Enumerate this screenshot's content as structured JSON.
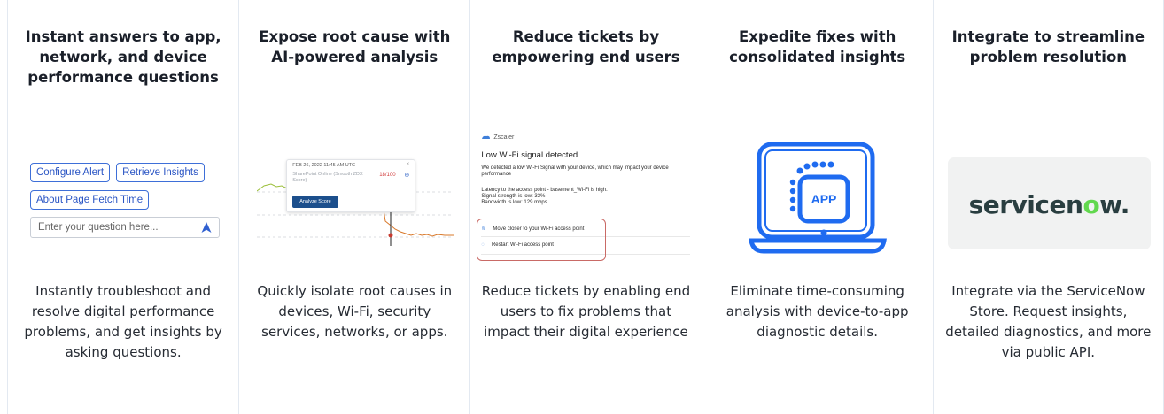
{
  "columns": [
    {
      "title": "Instant answers to app, network, and device performance questions",
      "chips": [
        "Configure Alert",
        "Retrieve Insights",
        "About Page Fetch Time"
      ],
      "input_placeholder": "Enter your question here...",
      "description": "Instantly troubleshoot and resolve digital performance problems, and get insights by asking questions."
    },
    {
      "title": "Expose root cause with AI-powered analysis",
      "tooltip": {
        "date": "FEB 26, 2022 11:45 AM UTC",
        "app": "SharePoint Online (Smooth ZDX Score)",
        "score": "18/100",
        "button": "Analyze Score"
      },
      "description": "Quickly isolate root causes in devices, Wi-Fi, security services, networks, or apps."
    },
    {
      "title": "Reduce tickets by empowering end users",
      "notification": {
        "brand": "Zscaler",
        "heading": "Low Wi-Fi signal detected",
        "body": "We detected a low Wi-Fi Signal with your device, which may impact your device performance",
        "details": [
          "Latency to the access point - basement_Wi-Fi is high.",
          "Signal strength is low: 33%",
          "Bandwidth is low: 129 mbps"
        ],
        "options": [
          "Move closer to your Wi-Fi access point",
          "Restart Wi-Fi access point"
        ]
      },
      "description": "Reduce tickets by enabling end users to fix problems that impact their digital experience"
    },
    {
      "title": "Expedite fixes with consolidated insights",
      "app_label": "APP",
      "description": "Eliminate time-consuming analysis with device-to-app diagnostic details."
    },
    {
      "title": "Integrate to streamline problem resolution",
      "logo": {
        "before": "servicen",
        "o": "o",
        "after": "w."
      },
      "description": "Integrate via the ServiceNow Store. Request insights, detailed diagnostics, and more via public API."
    }
  ],
  "colors": {
    "chip_blue": "#2a55c4",
    "laptop_blue": "#1f6bf0",
    "servicenow_dark": "#293e40",
    "servicenow_green": "#62d84e",
    "alert_red": "#c96a66"
  }
}
